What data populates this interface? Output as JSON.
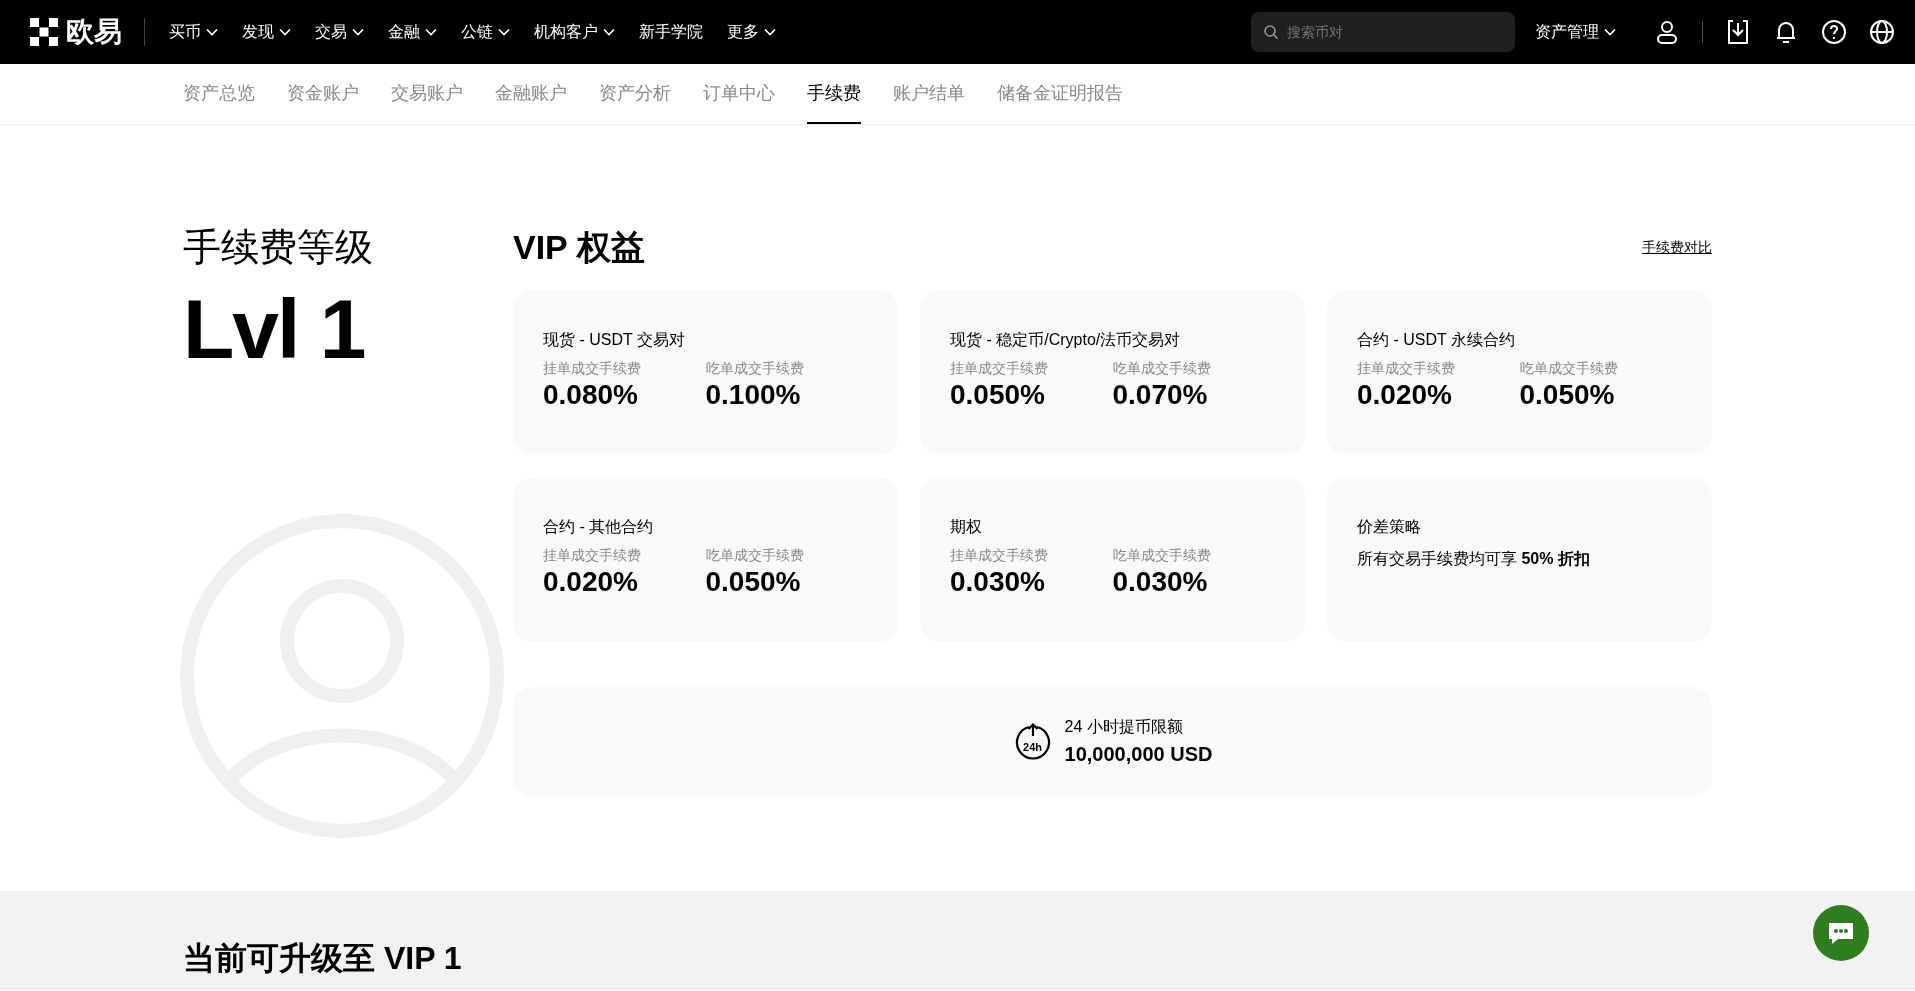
{
  "topnav": {
    "logo": "欧易",
    "items": [
      {
        "label": "买币",
        "has_menu": true
      },
      {
        "label": "发现",
        "has_menu": true
      },
      {
        "label": "交易",
        "has_menu": true
      },
      {
        "label": "金融",
        "has_menu": true
      },
      {
        "label": "公链",
        "has_menu": true
      },
      {
        "label": "机构客户",
        "has_menu": true
      },
      {
        "label": "新手学院",
        "has_menu": false
      },
      {
        "label": "更多",
        "has_menu": true
      }
    ],
    "search": {
      "placeholder": "搜索币对"
    },
    "assets_menu": {
      "label": "资产管理",
      "has_menu": true
    }
  },
  "tabs": [
    {
      "label": "资产总览",
      "selected": false
    },
    {
      "label": "资金账户",
      "selected": false
    },
    {
      "label": "交易账户",
      "selected": false
    },
    {
      "label": "金融账户",
      "selected": false
    },
    {
      "label": "资产分析",
      "selected": false
    },
    {
      "label": "订单中心",
      "selected": false
    },
    {
      "label": "手续费",
      "selected": true
    },
    {
      "label": "账户结单",
      "selected": false
    },
    {
      "label": "储备金证明报告",
      "selected": false
    }
  ],
  "fee_level": {
    "title": "手续费等级",
    "level": "Lvl 1"
  },
  "vip": {
    "title": "VIP 权益",
    "compare_link": "手续费对比",
    "cards": [
      {
        "kind": "fees",
        "title": "现货 - USDT 交易对",
        "maker_label": "挂单成交手续费",
        "maker": "0.080%",
        "taker_label": "吃单成交手续费",
        "taker": "0.100%"
      },
      {
        "kind": "fees",
        "title": "现货 - 稳定币/Crypto/法币交易对",
        "maker_label": "挂单成交手续费",
        "maker": "0.050%",
        "taker_label": "吃单成交手续费",
        "taker": "0.070%"
      },
      {
        "kind": "fees",
        "title": "合约 - USDT 永续合约",
        "maker_label": "挂单成交手续费",
        "maker": "0.020%",
        "taker_label": "吃单成交手续费",
        "taker": "0.050%"
      },
      {
        "kind": "fees",
        "title": "合约 - 其他合约",
        "maker_label": "挂单成交手续费",
        "maker": "0.020%",
        "taker_label": "吃单成交手续费",
        "taker": "0.050%"
      },
      {
        "kind": "fees",
        "title": "期权",
        "maker_label": "挂单成交手续费",
        "maker": "0.030%",
        "taker_label": "吃单成交手续费",
        "taker": "0.030%"
      },
      {
        "kind": "note",
        "title": "价差策略",
        "text": "所有交易手续费均可享 **50% 折扣**"
      }
    ],
    "withdrawal": {
      "icon_label": "24h",
      "label": "24 小时提币限额",
      "value": "10,000,000 USD"
    }
  },
  "upgrade": {
    "title": "当前可升级至 VIP 1"
  }
}
